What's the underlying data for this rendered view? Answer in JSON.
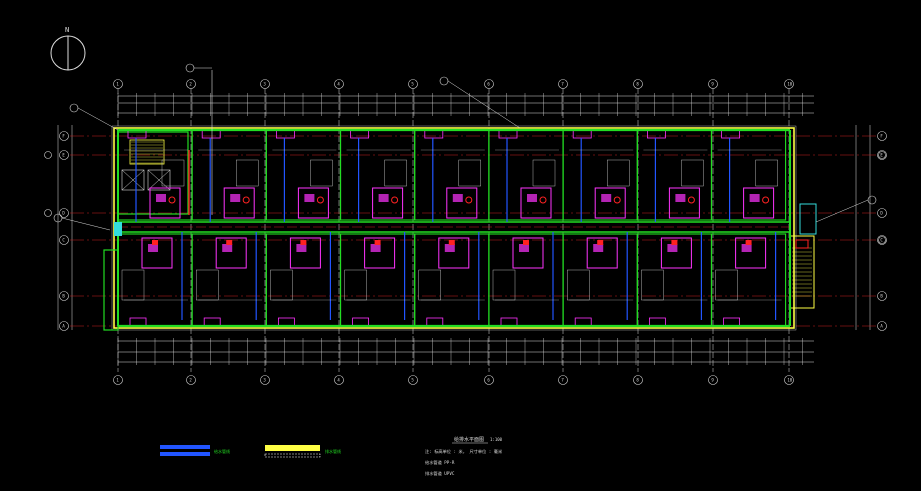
{
  "drawing": {
    "background": "#000000",
    "colors": {
      "wall": "#22dd22",
      "outline": "#ffff44",
      "axis": "#cc2222",
      "pipe": "#2255ff",
      "fixture": "#ff33ff",
      "dim": "#dddddd",
      "cyan": "#33dddd",
      "red": "#ff2222"
    },
    "north_arrow_label": "N",
    "column_grid_labels": [
      "1",
      "2",
      "3",
      "4",
      "5",
      "6",
      "7",
      "8",
      "9",
      "10"
    ],
    "row_grid_labels": [
      "F",
      "E",
      "D",
      "C",
      "B",
      "A"
    ],
    "room_count_per_row": 9,
    "legend": [
      {
        "label": "给水管线",
        "color": "#2255ff",
        "style": "solid"
      },
      {
        "label": "排水管线",
        "color": "#ffff44",
        "style": "hatch"
      }
    ],
    "notes": {
      "title": "给排水平面图",
      "scale": "1:100",
      "line1": "注: 标高单位 : 米，  尺寸单位 : 毫米",
      "line2": "给水管道    PP-R",
      "line3": "排水管道    UPVC"
    }
  }
}
